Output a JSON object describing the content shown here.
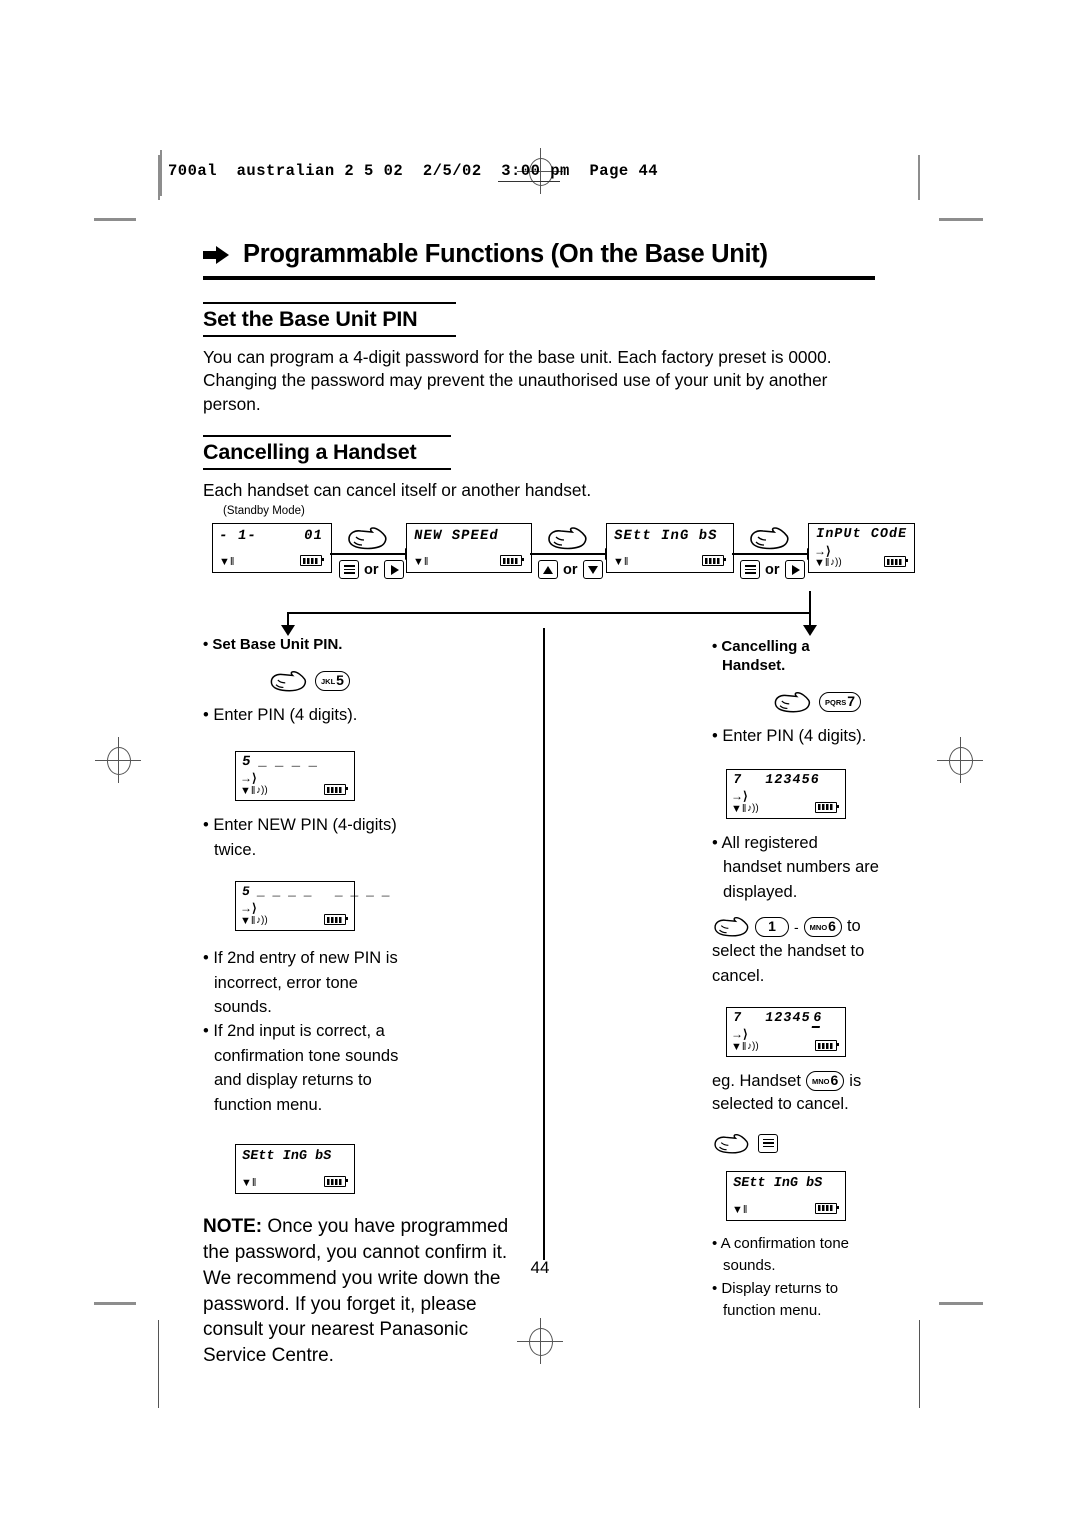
{
  "header": {
    "filename_line": "700al  australian 2 5 02  2/5/02  3:00 pm  Page 44"
  },
  "title": "Programmable Functions (On the Base Unit)",
  "sections": [
    {
      "heading": "Set the Base Unit PIN",
      "body": "You can program a 4-digit password for the base unit. Each factory preset is 0000. Changing the password may prevent the unauthorised use of your unit by another person."
    },
    {
      "heading": "Cancelling a Handset",
      "body": "Each handset can cancel itself or another handset."
    }
  ],
  "flow": {
    "standby_label": "(Standby Mode)",
    "steps": [
      {
        "lcd": {
          "line_left": "- 1-",
          "line_right": "01",
          "icons": [
            "antenna",
            "battery"
          ]
        },
        "keys": {
          "a": "menu",
          "or": "or",
          "b": "right-arrow"
        }
      },
      {
        "lcd": {
          "line_left": "NEW SPEEd",
          "line_right": "",
          "icons": [
            "antenna",
            "battery"
          ]
        },
        "keys": {
          "a": "up-arrow",
          "or": "or",
          "b": "down-arrow"
        }
      },
      {
        "lcd": {
          "line_left": "SEtt InG bS",
          "line_right": "",
          "icons": [
            "antenna",
            "battery"
          ]
        },
        "keys": {
          "a": "menu",
          "or": "or",
          "b": "right-arrow"
        }
      },
      {
        "lcd": {
          "line_left": "InPUt COdE",
          "line_right": "",
          "icons": [
            "in-arrow",
            "antenna",
            "speaker",
            "battery"
          ]
        },
        "keys": null
      }
    ]
  },
  "left_column": {
    "heading": "• Set Base Unit PIN.",
    "key": {
      "letters": "JKL",
      "number": "5"
    },
    "step1": "• Enter PIN (4 digits).",
    "lcd1": {
      "line1": "5 _ _ _ _"
    },
    "step2_line1": "• Enter NEW PIN (4-digits)",
    "step2_line2": "twice.",
    "lcd2": {
      "line1": "5 _ _ _ _   _ _ _ _"
    },
    "step3_line1": "• If 2nd entry of new PIN is",
    "step3_line2": "incorrect, error tone",
    "step3_line3": "sounds.",
    "step4_line1": "• If 2nd input is correct, a",
    "step4_line2": "confirmation tone sounds",
    "step4_line3": "and display returns to",
    "step4_line4": "function menu.",
    "lcd3": {
      "line1": "SEtt InG bS"
    },
    "note_label": "NOTE:",
    "note_text": " Once you have programmed the password, you cannot confirm it. We recommend you write down the password. If you forget it, please consult your nearest Panasonic Service Centre."
  },
  "right_column": {
    "heading_line1": "• Cancelling a",
    "heading_line2": "Handset.",
    "key": {
      "letters": "PQRS",
      "number": "7"
    },
    "step1": "• Enter PIN (4 digits).",
    "lcd1": {
      "line_left": "7",
      "line_right": "123456"
    },
    "step2_line1": "• All registered",
    "step2_line2": "handset numbers are",
    "step2_line3": "displayed.",
    "range_key_from": {
      "letters": "",
      "number": "1"
    },
    "range_dash": "-",
    "range_key_to": {
      "letters": "MNO",
      "number": "6"
    },
    "range_suffix": "to",
    "range_text_line1": "select the handset to",
    "range_text_line2": "cancel.",
    "lcd2": {
      "line_left": "7",
      "line_right": "12345",
      "selected": "6"
    },
    "eg_prefix": "eg. Handset",
    "eg_key": {
      "letters": "MNO",
      "number": "6"
    },
    "eg_suffix": "is",
    "eg_line2": "selected to cancel.",
    "menu_key": "menu",
    "lcd3": {
      "line1": "SEtt InG bS"
    },
    "final1_line1": "• A confirmation tone",
    "final1_line2": "sounds.",
    "final2_line1": "• Display returns to",
    "final2_line2": "function menu."
  },
  "page_number": "44",
  "icons": {
    "hand": "pointing-hand-icon",
    "menu": "menu-icon",
    "right_arrow": "right-arrow-icon",
    "up_arrow": "up-arrow-icon",
    "down_arrow": "down-arrow-icon",
    "antenna": "antenna-icon",
    "battery": "battery-icon",
    "speaker": "speaker-icon"
  }
}
